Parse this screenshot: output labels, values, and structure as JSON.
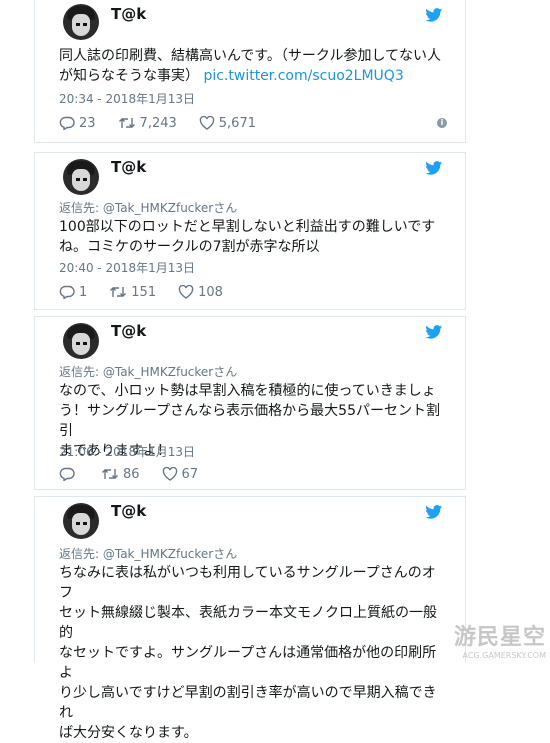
{
  "tweets": [
    {
      "author": "T@k",
      "reply_to_prefix": "",
      "reply_to_handle": "",
      "text_line1": "同人誌の印刷費、結構高いんです。（サークル参加してない人",
      "text_line2_plain": "が知らなそうな事実）",
      "text_link": "pic.twitter.com/scuo2LMUQ3",
      "text_line3": "",
      "timestamp": "20:34 - 2018年1月13日",
      "replies": "23",
      "retweets": "7,243",
      "likes": "5,671"
    },
    {
      "author": "T@k",
      "reply_to_prefix": "返信先: ",
      "reply_to_handle": "@Tak_HMKZfuckerさん",
      "text_line1": "100部以下のロットだと早割しないと利益出すの難しいです",
      "text_line2_plain": "ね。コミケのサークルの7割が赤字な所以",
      "text_line3": "",
      "timestamp": "20:40 - 2018年1月13日",
      "replies": "1",
      "retweets": "151",
      "likes": "108"
    },
    {
      "author": "T@k",
      "reply_to_prefix": "返信先: ",
      "reply_to_handle": "@Tak_HMKZfuckerさん",
      "text_line1": "なので、小ロット勢は早割入稿を積極的に使っていきましょ",
      "text_line2_plain": "う！サングループさんなら表示価格から最大55パーセント割引",
      "text_line3": "までありますよ！",
      "timestamp": "21:06 - 2018年1月13日",
      "replies": "",
      "retweets": "86",
      "likes": "67"
    },
    {
      "author": "T@k",
      "reply_to_prefix": "返信先: ",
      "reply_to_handle": "@Tak_HMKZfuckerさん",
      "text_line1": "ちなみに表は私がいつも利用しているサングループさんのオフ",
      "text_line2_plain": "セット無線綴じ製本、表紙カラー本文モノクロ上質紙の一般的",
      "text_line3": "なセットですよ。サングループさんは通常価格が他の印刷所よ",
      "text_line4": "り少し高いですけど早割の割引き率が高いので早期入稿できれ",
      "text_line5": "ば大分安くなります。"
    }
  ],
  "watermark": {
    "main": "游民星空",
    "sub": "ACG.GAMERSKY.COM"
  },
  "icons": {
    "bird": "twitter-bird-icon",
    "reply": "reply-icon",
    "retweet": "retweet-icon",
    "like": "heart-icon",
    "info": "info-icon"
  },
  "colors": {
    "brand": "#1da1f2",
    "link": "#1b95e0",
    "muted": "#657786"
  }
}
